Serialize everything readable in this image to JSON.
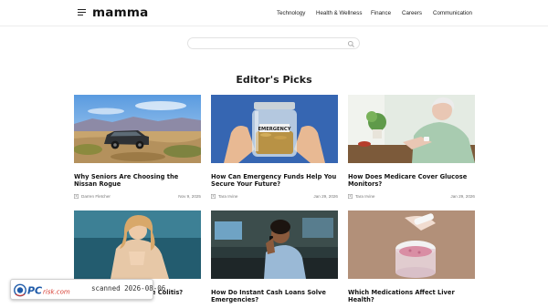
{
  "header": {
    "logo": "mamma",
    "nav": [
      {
        "label": "Technology"
      },
      {
        "label": "Health & Wellness"
      },
      {
        "label": "Finance"
      },
      {
        "label": "Careers"
      },
      {
        "label": "Communication"
      }
    ]
  },
  "search": {
    "value": "",
    "placeholder": ""
  },
  "section": {
    "title": "Editor's Picks"
  },
  "cards": [
    {
      "title": "Why Seniors Are Choosing the Nissan Rogue",
      "author": "Darren Fletcher",
      "date": "Nov 9, 2025",
      "image": "suv-in-desert"
    },
    {
      "title": "How Can Emergency Funds Help You Secure Your Future?",
      "author": "Tara Irvine",
      "date": "Jan 29, 2026",
      "image": "jar-of-coins"
    },
    {
      "title": "How Does Medicare Cover Glucose Monitors?",
      "author": "Tara Irvine",
      "date": "Jan 29, 2026",
      "image": "senior-woman-glucose-monitor"
    },
    {
      "title": "Ulcerative Colitis?",
      "author": "",
      "date": "",
      "image": "woman-on-couch"
    },
    {
      "title": "How Do Instant Cash Loans Solve Emergencies?",
      "author": "",
      "date": "",
      "image": "woman-at-desk-with-phone"
    },
    {
      "title": "Which Medications Affect Liver Health?",
      "author": "",
      "date": "",
      "image": "pills-in-hand"
    }
  ],
  "watermark": {
    "logo_text": "PCrisk.com",
    "scan_text": "scanned 2026-08-06"
  },
  "colors": {
    "accent": "#1a1a1a",
    "watermark_blue": "#1e5aa8",
    "watermark_red": "#d63a2f"
  }
}
